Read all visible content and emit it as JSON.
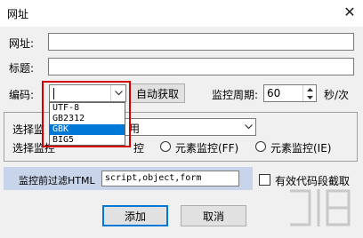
{
  "window": {
    "title": "网址",
    "close_glyph": "✕"
  },
  "fields": {
    "url_label": "网址:",
    "title_label": "标题:",
    "encoding_label": "编码:",
    "encoding_value": "",
    "auto_get_button": "自动获取",
    "period_label": "监控周期:",
    "period_value": "60",
    "period_unit": "秒/次"
  },
  "encoding_options": [
    "UTF-8",
    "GB2312",
    "GBK",
    "BIG5"
  ],
  "encoding_selected_index": 2,
  "monitor": {
    "select_label": "选择监",
    "select_value": "用",
    "mode_label": "选择监控",
    "mode_option_1": "控",
    "mode_option_2": "元素监控(FF)",
    "mode_option_3": "元素监控(IE)"
  },
  "filter": {
    "label": "监控前过滤HTML",
    "value": "script,object,form",
    "checkbox_label": "有效代码段截取"
  },
  "buttons": {
    "add": "添加",
    "cancel": "取消"
  }
}
